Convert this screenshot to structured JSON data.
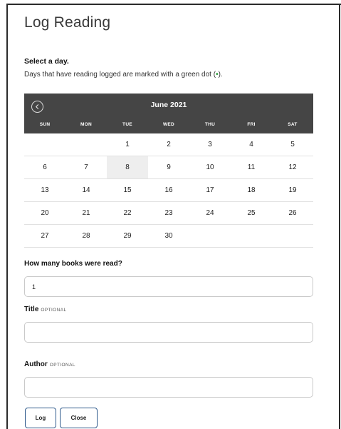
{
  "dialog": {
    "title": "Log Reading",
    "select_day_label": "Select a day.",
    "hint_prefix": "Days that have reading logged are marked with a green dot (",
    "hint_dot": "•",
    "hint_suffix": ")."
  },
  "calendar": {
    "month_label": "June 2021",
    "weekdays": [
      "SUN",
      "MON",
      "TUE",
      "WED",
      "THU",
      "FRI",
      "SAT"
    ],
    "weeks": [
      [
        "",
        "",
        "1",
        "2",
        "3",
        "4",
        "5"
      ],
      [
        "6",
        "7",
        "8",
        "9",
        "10",
        "11",
        "12"
      ],
      [
        "13",
        "14",
        "15",
        "16",
        "17",
        "18",
        "19"
      ],
      [
        "20",
        "21",
        "22",
        "23",
        "24",
        "25",
        "26"
      ],
      [
        "27",
        "28",
        "29",
        "30",
        "",
        "",
        ""
      ]
    ],
    "highlighted_day": "8",
    "prev_icon": "chevron-left-circle-icon"
  },
  "form": {
    "books_label": "How many books were read?",
    "books_value": "1",
    "title_label": "Title",
    "title_optional": "OPTIONAL",
    "title_value": "",
    "author_label": "Author",
    "author_optional": "OPTIONAL",
    "author_value": ""
  },
  "actions": {
    "log_label": "Log",
    "close_label": "Close"
  },
  "colors": {
    "header_bg": "#454545",
    "accent_border": "#2f5a8c",
    "logged_dot": "#2e9b3c"
  }
}
